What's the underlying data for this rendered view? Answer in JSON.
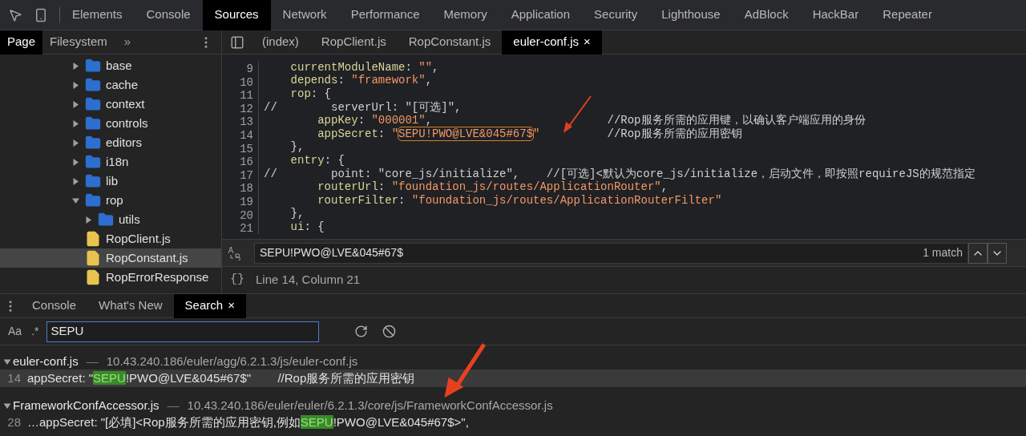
{
  "main_tabs": [
    {
      "label": "Elements",
      "selected": false
    },
    {
      "label": "Console",
      "selected": false
    },
    {
      "label": "Sources",
      "selected": true
    },
    {
      "label": "Network",
      "selected": false
    },
    {
      "label": "Performance",
      "selected": false
    },
    {
      "label": "Memory",
      "selected": false
    },
    {
      "label": "Application",
      "selected": false
    },
    {
      "label": "Security",
      "selected": false
    },
    {
      "label": "Lighthouse",
      "selected": false
    },
    {
      "label": "AdBlock",
      "selected": false
    },
    {
      "label": "HackBar",
      "selected": false
    },
    {
      "label": "Repeater",
      "selected": false
    }
  ],
  "navigator": {
    "tabs": [
      {
        "label": "Page",
        "selected": true
      },
      {
        "label": "Filesystem",
        "selected": false
      }
    ],
    "more": "»",
    "tree": [
      {
        "name": "base",
        "kind": "folder",
        "expanded": false
      },
      {
        "name": "cache",
        "kind": "folder",
        "expanded": false
      },
      {
        "name": "context",
        "kind": "folder",
        "expanded": false
      },
      {
        "name": "controls",
        "kind": "folder",
        "expanded": false
      },
      {
        "name": "editors",
        "kind": "folder",
        "expanded": false
      },
      {
        "name": "i18n",
        "kind": "folder",
        "expanded": false
      },
      {
        "name": "lib",
        "kind": "folder",
        "expanded": false
      },
      {
        "name": "rop",
        "kind": "folder",
        "expanded": true,
        "children": [
          {
            "name": "utils",
            "kind": "folder",
            "expanded": false
          },
          {
            "name": "RopClient.js",
            "kind": "file",
            "selected": false
          },
          {
            "name": "RopConstant.js",
            "kind": "file",
            "selected": true
          },
          {
            "name": "RopErrorResponse",
            "kind": "file",
            "selected": false
          }
        ]
      }
    ]
  },
  "editor": {
    "tabs": [
      {
        "label": "(index)",
        "selected": false,
        "closable": false
      },
      {
        "label": "RopClient.js",
        "selected": false,
        "closable": false
      },
      {
        "label": "RopConstant.js",
        "selected": false,
        "closable": false
      },
      {
        "label": "euler-conf.js",
        "selected": true,
        "closable": true
      }
    ],
    "close_glyph": "×",
    "lines": [
      {
        "number": "9",
        "segments": [
          {
            "text": "    currentModuleName",
            "kind": "key"
          },
          {
            "text": ": ",
            "kind": "punct"
          },
          {
            "text": "\"\"",
            "kind": "str"
          },
          {
            "text": ",",
            "kind": "punct"
          }
        ]
      },
      {
        "number": "10",
        "segments": [
          {
            "text": "    depends",
            "kind": "key"
          },
          {
            "text": ": ",
            "kind": "punct"
          },
          {
            "text": "\"framework\"",
            "kind": "str"
          },
          {
            "text": ",",
            "kind": "punct"
          }
        ]
      },
      {
        "number": "11",
        "segments": [
          {
            "text": "    rop",
            "kind": "key"
          },
          {
            "text": ": {",
            "kind": "punct"
          }
        ]
      },
      {
        "number": "12",
        "segments": [
          {
            "text": "//        serverUrl: \"[可选]\",",
            "kind": "comment"
          }
        ]
      },
      {
        "number": "13",
        "segments": [
          {
            "text": "        appKey",
            "kind": "key"
          },
          {
            "text": ": ",
            "kind": "punct"
          },
          {
            "text": "\"000001\"",
            "kind": "str"
          },
          {
            "text": ",                          ",
            "kind": "punct"
          },
          {
            "text": "//Rop服务所需的应用键，以确认客户端应用的身份",
            "kind": "comment"
          }
        ]
      },
      {
        "number": "14",
        "segments": [
          {
            "text": "        appSecret",
            "kind": "key"
          },
          {
            "text": ": ",
            "kind": "punct"
          },
          {
            "text": "\"",
            "kind": "str"
          },
          {
            "text": "SEPU!PWO@LVE&045#67$",
            "kind": "found"
          },
          {
            "text": "\"",
            "kind": "str"
          },
          {
            "text": "          //Rop服务所需的应用密钥",
            "kind": "comment"
          }
        ]
      },
      {
        "number": "15",
        "segments": [
          {
            "text": "    },",
            "kind": "punct"
          }
        ]
      },
      {
        "number": "16",
        "segments": [
          {
            "text": "    entry",
            "kind": "key"
          },
          {
            "text": ": {",
            "kind": "punct"
          }
        ]
      },
      {
        "number": "17",
        "segments": [
          {
            "text": "//        point: \"core_js/initialize\",    //[可选]<默认为core_js/initialize，启动文件，即按照requireJS的规范指定",
            "kind": "comment"
          }
        ]
      },
      {
        "number": "18",
        "segments": [
          {
            "text": "        routerUrl",
            "kind": "key"
          },
          {
            "text": ": ",
            "kind": "punct"
          },
          {
            "text": "\"foundation_js/routes/ApplicationRouter\"",
            "kind": "str"
          },
          {
            "text": ",",
            "kind": "punct"
          }
        ]
      },
      {
        "number": "19",
        "segments": [
          {
            "text": "        routerFilter",
            "kind": "key"
          },
          {
            "text": ": ",
            "kind": "punct"
          },
          {
            "text": "\"foundation_js/routes/ApplicationRouterFilter\"",
            "kind": "str"
          }
        ]
      },
      {
        "number": "20",
        "segments": [
          {
            "text": "    },",
            "kind": "punct"
          }
        ]
      },
      {
        "number": "21",
        "segments": [
          {
            "text": "    ui",
            "kind": "key"
          },
          {
            "text": ": {",
            "kind": "punct"
          }
        ]
      }
    ],
    "find": {
      "value": "SEPU!PWO@LVE&045#67$",
      "count": "1 match"
    },
    "status": {
      "braces": "{}",
      "position": "Line 14, Column 21"
    }
  },
  "drawer": {
    "tabs": [
      {
        "label": "Console",
        "selected": false,
        "closable": false
      },
      {
        "label": "What's New",
        "selected": false,
        "closable": false
      },
      {
        "label": "Search",
        "selected": true,
        "closable": true
      }
    ],
    "close_glyph": "×",
    "options": [
      {
        "label": "Aa",
        "on": false
      },
      {
        "label": ".*",
        "on": false
      }
    ],
    "query": "SEPU",
    "separator": "—",
    "results": [
      {
        "file": "euler-conf.js",
        "path": "10.43.240.186/euler/agg/6.2.1.3/js/euler-conf.js",
        "expanded": true,
        "matches": [
          {
            "line": "14",
            "selected": true,
            "segments": [
              {
                "text": "appSecret: \"",
                "kind": "plain"
              },
              {
                "text": "SEPU",
                "kind": "match"
              },
              {
                "text": "!PWO@LVE&045#67$\"        //Rop服务所需的应用密钥",
                "kind": "plain"
              }
            ]
          }
        ]
      },
      {
        "file": "FrameworkConfAccessor.js",
        "path": "10.43.240.186/euler/euler/6.2.1.3/core/js/FrameworkConfAccessor.js",
        "expanded": true,
        "matches": [
          {
            "line": "28",
            "selected": false,
            "segments": [
              {
                "text": "…appSecret: \"[必填]<Rop服务所需的应用密钥,例如",
                "kind": "plain"
              },
              {
                "text": "SEPU",
                "kind": "match"
              },
              {
                "text": "!PWO@LVE&045#67$>\",",
                "kind": "plain"
              }
            ]
          }
        ]
      }
    ]
  }
}
